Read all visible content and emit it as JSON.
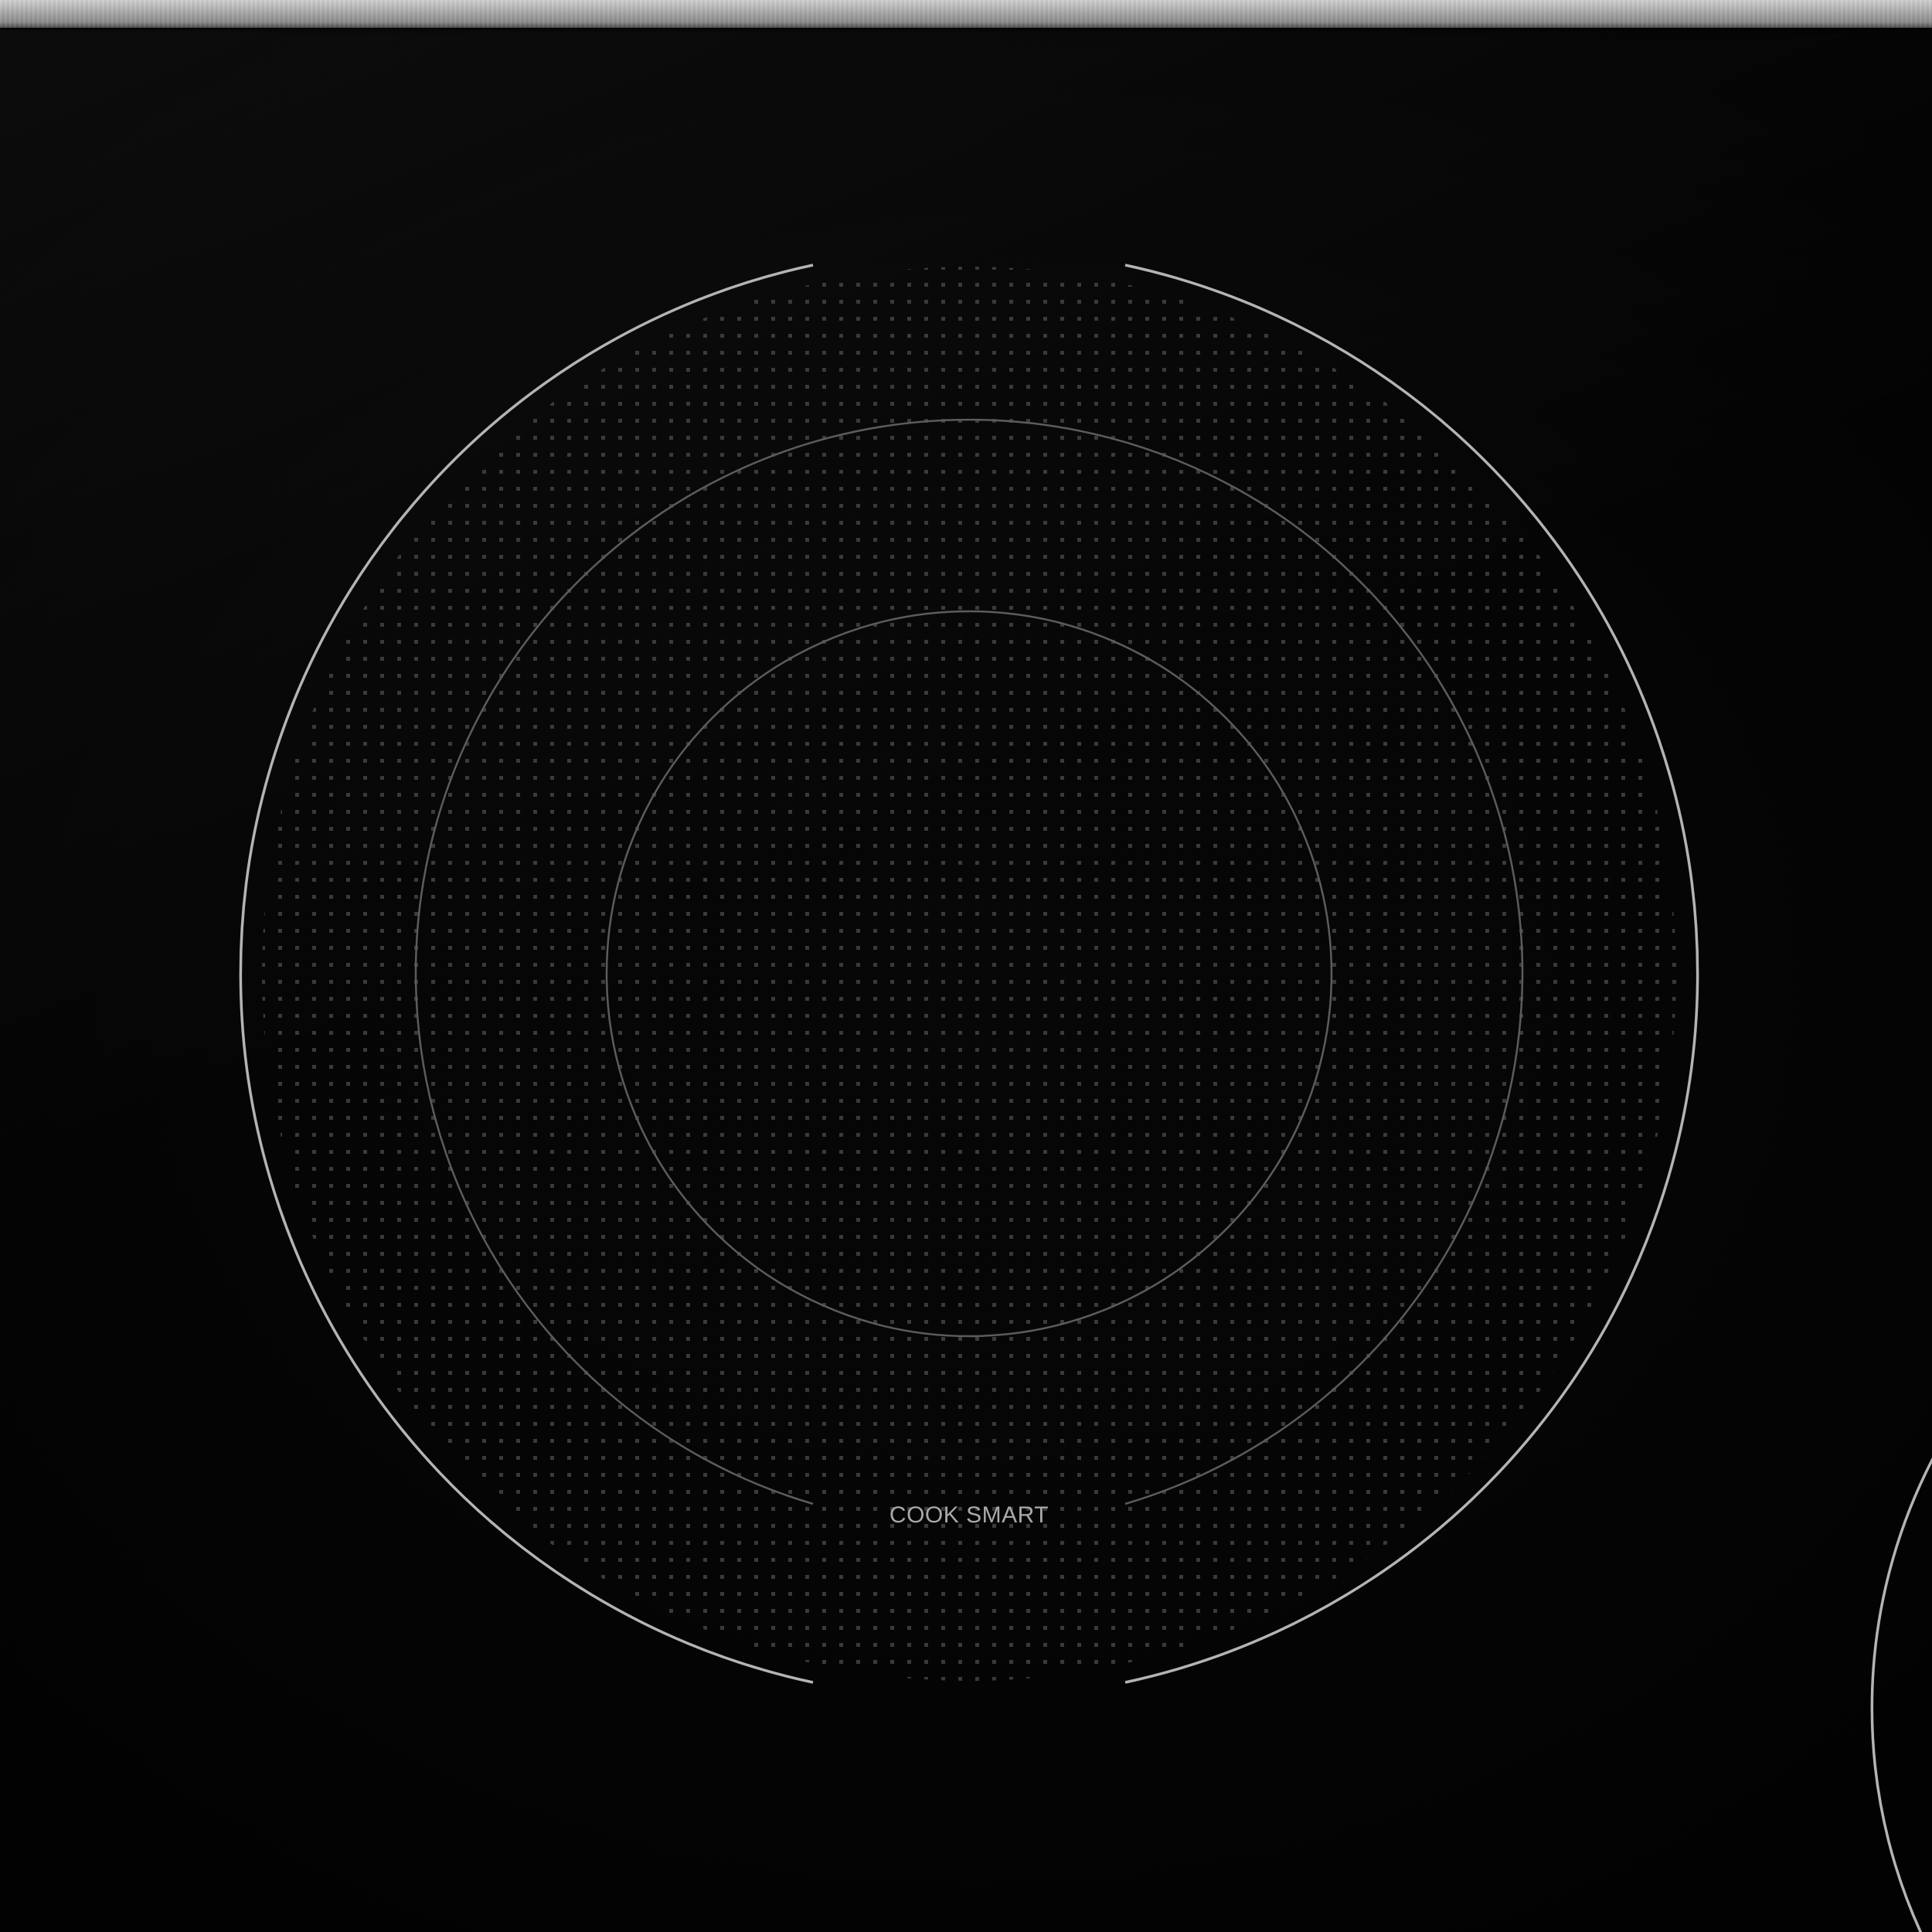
{
  "cooktop": {
    "zone_label": "COOK SMART"
  },
  "colors": {
    "glass": "#050505",
    "outer_ring": "#b4b4b4",
    "inner_rings": "#5c5c5c",
    "dot_pattern": "#3a3a3a",
    "label_text": "#a9a9a9",
    "trim": "#a8a8a8"
  },
  "icons": {
    "burner_main": "cooking-zone-icon",
    "burner_side": "cooking-zone-icon"
  }
}
